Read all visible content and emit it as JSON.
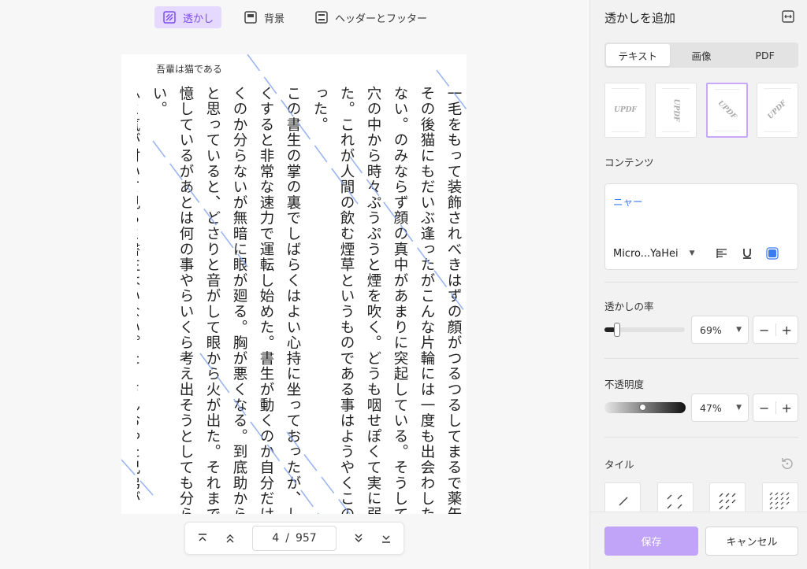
{
  "toolbar": {
    "watermark_label": "透かし",
    "background_label": "背景",
    "header_footer_label": "ヘッダーとフッター"
  },
  "document": {
    "header": "吾輩は猫である",
    "paragraphs": [
      "一毛をもって装飾されべきはずの顔がつるつるしてまるで薬缶だ。その後猫にもだいぶ逢ったがこんな片輪には一度も出会わした事がない。のみならず顔の真中があまりに突起している。そうしてその穴の中から時々ぷうぷうと煙を吹く。どうも咽せぽくて実に弱った。これが人間の飲む煙草というものである事はようやくこの頃知った。",
      "この書生の掌の裏でしばらくはよい心持に坐っておったが、しばらくすると非常な速力で運転し始めた。書生が動くのか自分だけが動くのか分らないが無暗に眼が廻る。胸が悪くなる。到底助からないと思っていると、どさりと音がして眼から火が出た。それまでは記憶しているがあとは何の事やらいくら考え出そうとしても分らない。",
      "ふと気が付いて見ると書生はいない。たくさんおった兄弟が"
    ]
  },
  "pager": {
    "current": "4",
    "separator": "/",
    "total": "957"
  },
  "panel": {
    "title": "透かしを追加",
    "tabs": [
      "テキスト",
      "画像",
      "PDF"
    ],
    "active_tab": "テキスト",
    "presets": [
      "UPDF",
      "UPDF",
      "UPDF",
      "UPDF"
    ],
    "content_label": "コンテンツ",
    "content_text": "ニャー",
    "font_name": "Micro...YaHei",
    "ratio_label": "透かしの率",
    "ratio_value": "69%",
    "opacity_label": "不透明度",
    "opacity_value": "47%",
    "tile_label": "タイル",
    "save_label": "保存",
    "cancel_label": "キャンセル",
    "text_color": "#3b7bf0",
    "accent_color": "#c1a3f7"
  }
}
